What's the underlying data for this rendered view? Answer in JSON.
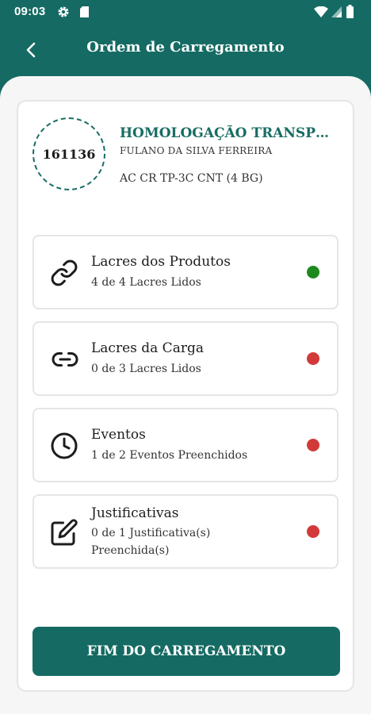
{
  "status_bar": {
    "time": "09:03",
    "icons": [
      "gear-icon",
      "sd-card-icon",
      "wifi-icon",
      "signal-icon",
      "battery-icon"
    ]
  },
  "app_bar": {
    "title": "Ordem de Carregamento",
    "back_icon": "chevron-left-icon"
  },
  "order": {
    "number": "161136",
    "company": "HOMOLOGAÇÃO TRANSPOR...",
    "driver": "FULANO DA SILVA FERREIRA",
    "vehicle": "AC CR TP-3C CNT (4 BG)"
  },
  "items": [
    {
      "title": "Lacres dos Produtos",
      "subtitle": "4 de 4 Lacres Lidos",
      "icon": "link-icon",
      "status": "complete",
      "status_color": "#1e8a1e"
    },
    {
      "title": "Lacres da Carga",
      "subtitle": "0 de 3 Lacres Lidos",
      "icon": "link-horizontal-icon",
      "status": "pending",
      "status_color": "#d23a3a"
    },
    {
      "title": "Eventos",
      "subtitle": "1 de 2 Eventos Preenchidos",
      "icon": "clock-icon",
      "status": "pending",
      "status_color": "#d23a3a"
    },
    {
      "title": "Justificativas",
      "subtitle": "0 de 1 Justificativa(s) Preenchida(s)",
      "icon": "edit-icon",
      "status": "pending",
      "status_color": "#d23a3a"
    }
  ],
  "finish_button": {
    "label": "FIM DO CARREGAMENTO"
  },
  "colors": {
    "primary": "#156b63",
    "accent_text": "#176d64",
    "complete": "#1e8a1e",
    "pending": "#d23a3a"
  }
}
